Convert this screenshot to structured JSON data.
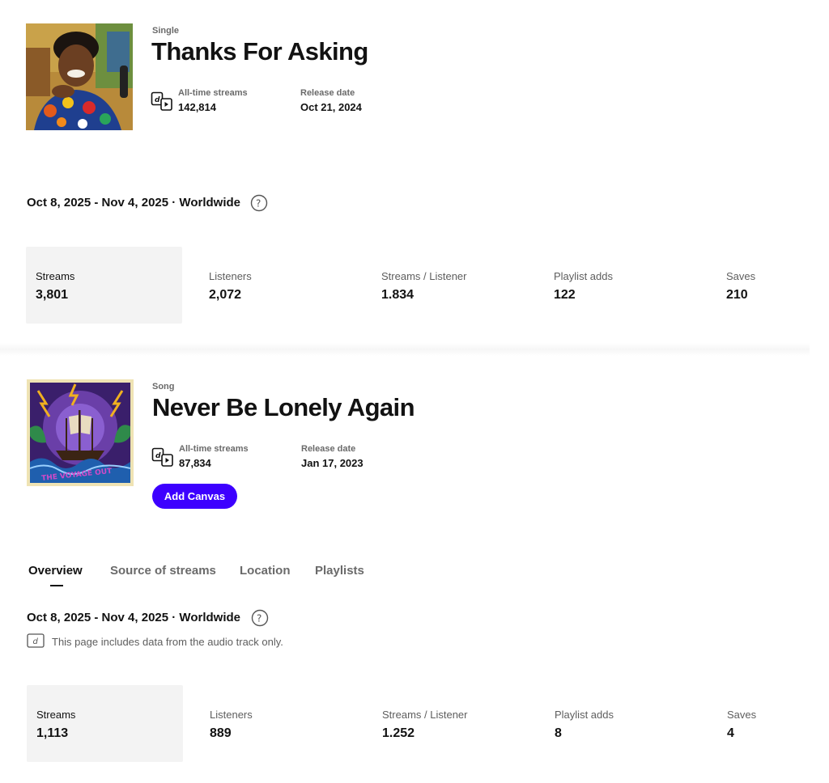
{
  "releases": [
    {
      "type": "Single",
      "title": "Thanks For Asking",
      "cover_icon": "portrait-artwork",
      "alltime_label": "All-time streams",
      "alltime_value": "142,814",
      "release_label": "Release date",
      "release_value": "Oct 21, 2024",
      "range": "Oct 8, 2025 - Nov 4, 2025 · Worldwide",
      "stats": [
        {
          "label": "Streams",
          "value": "3,801",
          "selected": true
        },
        {
          "label": "Listeners",
          "value": "2,072"
        },
        {
          "label": "Streams / Listener",
          "value": "1.834"
        },
        {
          "label": "Playlist adds",
          "value": "122"
        },
        {
          "label": "Saves",
          "value": "210"
        }
      ]
    },
    {
      "type": "Song",
      "title": "Never Be Lonely Again",
      "cover_icon": "ship-artwork",
      "cover_text": "THE VOYAGE OUT",
      "alltime_label": "All-time streams",
      "alltime_value": "87,834",
      "release_label": "Release date",
      "release_value": "Jan 17, 2023",
      "add_canvas_label": "Add Canvas",
      "tabs": [
        {
          "label": "Overview",
          "active": true
        },
        {
          "label": "Source of streams"
        },
        {
          "label": "Location"
        },
        {
          "label": "Playlists"
        }
      ],
      "range": "Oct 8, 2025 - Nov 4, 2025 · Worldwide",
      "note": "This page includes data from the audio track only.",
      "stats": [
        {
          "label": "Streams",
          "value": "1,113",
          "selected": true
        },
        {
          "label": "Listeners",
          "value": "889"
        },
        {
          "label": "Streams / Listener",
          "value": "1.252"
        },
        {
          "label": "Playlist adds",
          "value": "8"
        },
        {
          "label": "Saves",
          "value": "4"
        }
      ]
    }
  ],
  "colors": {
    "accent": "#3d00ff",
    "text": "#121212",
    "muted": "#6a6a6a",
    "selected_bg": "#f3f3f3"
  }
}
